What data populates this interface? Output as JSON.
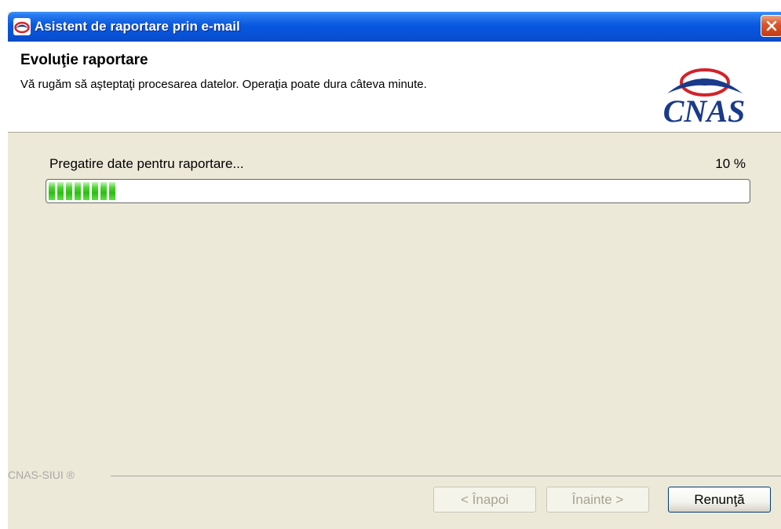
{
  "window": {
    "title": "Asistent de raportare prin e-mail"
  },
  "header": {
    "title": "Evoluţie raportare",
    "subtitle": "Vă rugăm să aşteptaţi procesarea datelor. Operaţia poate dura câteva minute.",
    "logo_text": "CNAS"
  },
  "progress": {
    "status": "Pregatire date pentru raportare...",
    "percent_label": "10 %",
    "value": 0.1
  },
  "footer": {
    "brand": "CNAS-SIUI ®"
  },
  "buttons": {
    "back": "< Înapoi",
    "next": "Înainte >",
    "cancel": "Renunţă"
  },
  "colors": {
    "titlebar": "#0958df",
    "dialog_bg": "#ece9d8",
    "progress_green": "#2cbe13",
    "logo_blue": "#1a3a8a",
    "logo_red": "#d2232a"
  },
  "icons": {
    "title": "cnas-app-icon",
    "close": "close-icon",
    "logo": "cnas-logo"
  }
}
